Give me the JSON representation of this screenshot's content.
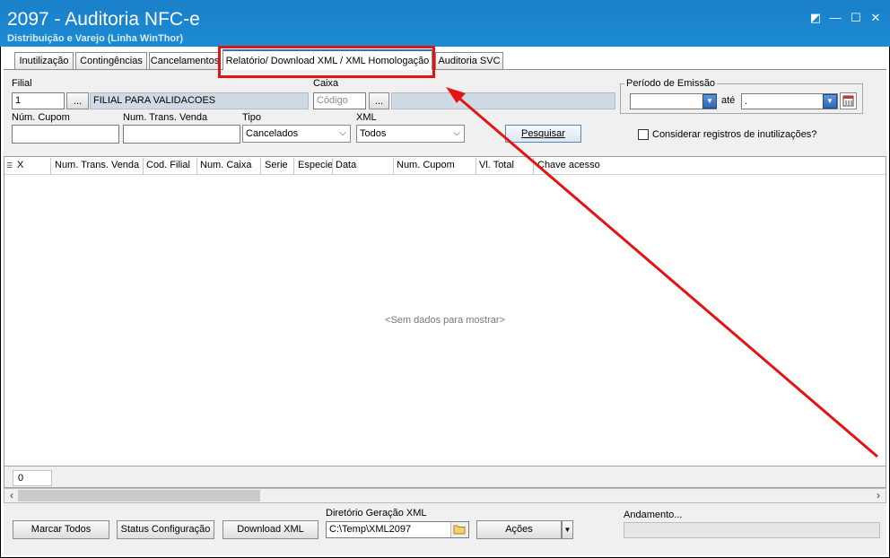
{
  "window": {
    "title": "2097 - Auditoria NFC-e",
    "subtitle": "Distribuição e Varejo (Linha WinThor)",
    "controls": {
      "restore": "◩",
      "minimize": "—",
      "maximize": "☐",
      "close": "✕"
    }
  },
  "tabs": [
    {
      "label": "Inutilização",
      "active": false
    },
    {
      "label": "Contingências",
      "active": false
    },
    {
      "label": "Cancelamentos",
      "active": false
    },
    {
      "label": "Relatório/ Download XML / XML Homologação",
      "active": true
    },
    {
      "label": "Auditoria SVC",
      "active": false
    }
  ],
  "filters": {
    "filial": {
      "label": "Filial",
      "value": "1",
      "lookup": "...",
      "description": "FILIAL PARA VALIDACOES"
    },
    "caixa": {
      "label": "Caixa",
      "placeholder": "Código",
      "lookup": "...",
      "description": ""
    },
    "periodo": {
      "label": "Período de Emissão",
      "start": "",
      "end": ".",
      "separator": "até"
    },
    "num_cupom": {
      "label": "Núm. Cupom",
      "value": ""
    },
    "num_trans_venda": {
      "label": "Num. Trans. Venda",
      "value": ""
    },
    "tipo": {
      "label": "Tipo",
      "selected": "Cancelados"
    },
    "xml": {
      "label": "XML",
      "selected": "Todos"
    },
    "pesquisar": "Pesquisar",
    "considerar": {
      "label": "Considerar registros de inutilizações?",
      "checked": false
    }
  },
  "grid": {
    "columns": [
      "X",
      "Num. Trans. Venda",
      "Cod. Filial",
      "Num. Caixa",
      "Serie",
      "Especie",
      "Data",
      "Num. Cupom",
      "Vl. Total",
      "Chave acesso"
    ],
    "empty_text": "<Sem dados para mostrar>",
    "footer_count": "0"
  },
  "actions": {
    "marcar_todos": "Marcar Todos",
    "status_config": "Status Configuração",
    "download_xml": "Download XML",
    "diretorio_label": "Diretório Geração XML",
    "diretorio_value": "C:\\Temp\\XML2097",
    "acoes": "Ações",
    "andamento_label": "Andamento..."
  },
  "colors": {
    "titlebar": "#1b86cf",
    "annotation": "#e51414",
    "active_tab_accent": "#2f6fc4"
  }
}
